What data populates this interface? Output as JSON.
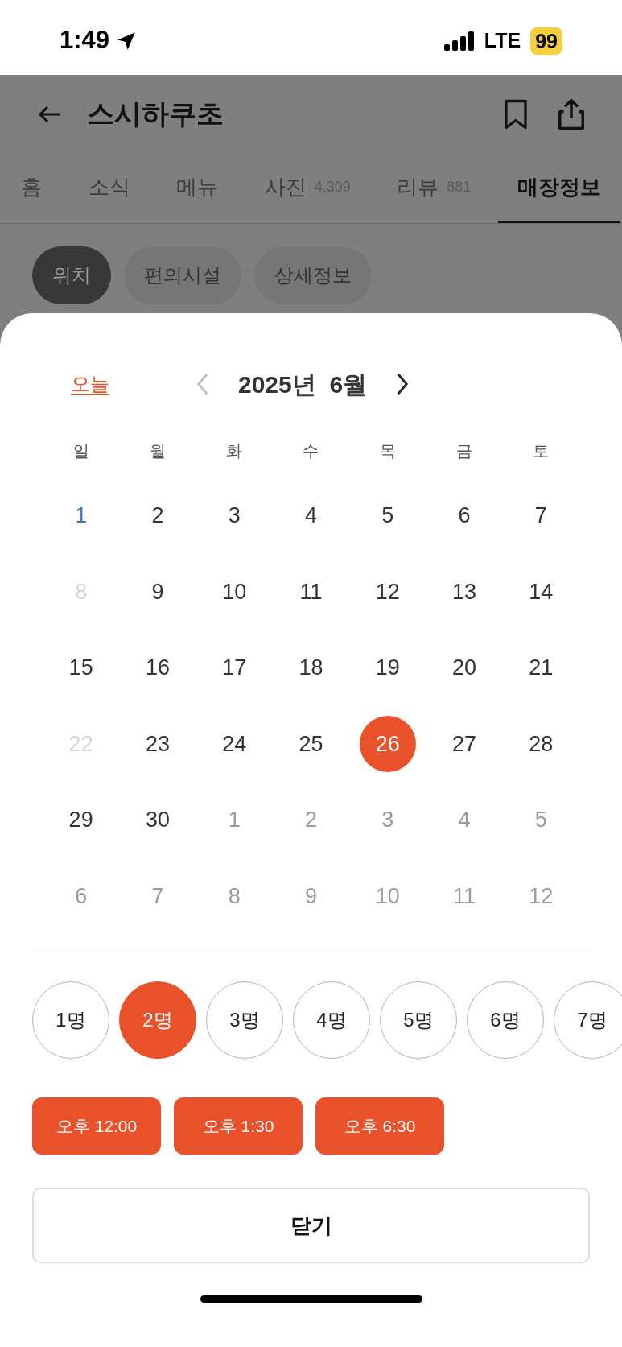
{
  "status_bar": {
    "time": "1:49",
    "network": "LTE",
    "battery": "99"
  },
  "header": {
    "title": "스시하쿠초"
  },
  "tabs": [
    {
      "label": "홈",
      "selected": false
    },
    {
      "label": "소식",
      "selected": false
    },
    {
      "label": "메뉴",
      "selected": false
    },
    {
      "label": "사진",
      "count": "4,309",
      "selected": false
    },
    {
      "label": "리뷰",
      "count": "881",
      "selected": false
    },
    {
      "label": "매장정보",
      "selected": true
    }
  ],
  "chips": [
    {
      "label": "위치",
      "selected": true
    },
    {
      "label": "편의시설",
      "selected": false
    },
    {
      "label": "상세정보",
      "selected": false
    }
  ],
  "calendar": {
    "today_link": "오늘",
    "month_title": "2025년  6월",
    "weekdays": [
      "일",
      "월",
      "화",
      "수",
      "목",
      "금",
      "토"
    ],
    "weeks": [
      [
        {
          "day": "1",
          "kind": "holiday",
          "selected": false
        },
        {
          "day": "2",
          "kind": "normal",
          "selected": false
        },
        {
          "day": "3",
          "kind": "normal",
          "selected": false
        },
        {
          "day": "4",
          "kind": "normal",
          "selected": false
        },
        {
          "day": "5",
          "kind": "normal",
          "selected": false
        },
        {
          "day": "6",
          "kind": "normal",
          "selected": false
        },
        {
          "day": "7",
          "kind": "normal",
          "selected": false
        }
      ],
      [
        {
          "day": "8",
          "kind": "unavailable",
          "selected": false
        },
        {
          "day": "9",
          "kind": "normal",
          "selected": false
        },
        {
          "day": "10",
          "kind": "normal",
          "selected": false
        },
        {
          "day": "11",
          "kind": "normal",
          "selected": false
        },
        {
          "day": "12",
          "kind": "normal",
          "selected": false
        },
        {
          "day": "13",
          "kind": "normal",
          "selected": false
        },
        {
          "day": "14",
          "kind": "normal",
          "selected": false
        }
      ],
      [
        {
          "day": "15",
          "kind": "normal",
          "selected": false
        },
        {
          "day": "16",
          "kind": "normal",
          "selected": false
        },
        {
          "day": "17",
          "kind": "normal",
          "selected": false
        },
        {
          "day": "18",
          "kind": "normal",
          "selected": false
        },
        {
          "day": "19",
          "kind": "normal",
          "selected": false
        },
        {
          "day": "20",
          "kind": "normal",
          "selected": false
        },
        {
          "day": "21",
          "kind": "normal",
          "selected": false
        }
      ],
      [
        {
          "day": "22",
          "kind": "unavailable",
          "selected": false
        },
        {
          "day": "23",
          "kind": "normal",
          "selected": false
        },
        {
          "day": "24",
          "kind": "normal",
          "selected": false
        },
        {
          "day": "25",
          "kind": "normal",
          "selected": false
        },
        {
          "day": "26",
          "kind": "normal",
          "selected": true
        },
        {
          "day": "27",
          "kind": "normal",
          "selected": false
        },
        {
          "day": "28",
          "kind": "normal",
          "selected": false
        }
      ],
      [
        {
          "day": "29",
          "kind": "normal",
          "selected": false
        },
        {
          "day": "30",
          "kind": "normal",
          "selected": false
        },
        {
          "day": "1",
          "kind": "outside",
          "selected": false
        },
        {
          "day": "2",
          "kind": "outside",
          "selected": false
        },
        {
          "day": "3",
          "kind": "outside",
          "selected": false
        },
        {
          "day": "4",
          "kind": "outside",
          "selected": false
        },
        {
          "day": "5",
          "kind": "outside",
          "selected": false
        }
      ],
      [
        {
          "day": "6",
          "kind": "outside",
          "selected": false
        },
        {
          "day": "7",
          "kind": "outside",
          "selected": false
        },
        {
          "day": "8",
          "kind": "outside",
          "selected": false
        },
        {
          "day": "9",
          "kind": "outside",
          "selected": false
        },
        {
          "day": "10",
          "kind": "outside",
          "selected": false
        },
        {
          "day": "11",
          "kind": "outside",
          "selected": false
        },
        {
          "day": "12",
          "kind": "outside",
          "selected": false
        }
      ]
    ]
  },
  "party_sizes": [
    {
      "label": "1명",
      "selected": false
    },
    {
      "label": "2명",
      "selected": true
    },
    {
      "label": "3명",
      "selected": false
    },
    {
      "label": "4명",
      "selected": false
    },
    {
      "label": "5명",
      "selected": false
    },
    {
      "label": "6명",
      "selected": false
    },
    {
      "label": "7명",
      "selected": false
    }
  ],
  "times": [
    "오후 12:00",
    "오후 1:30",
    "오후 6:30"
  ],
  "close_button": "닫기"
}
